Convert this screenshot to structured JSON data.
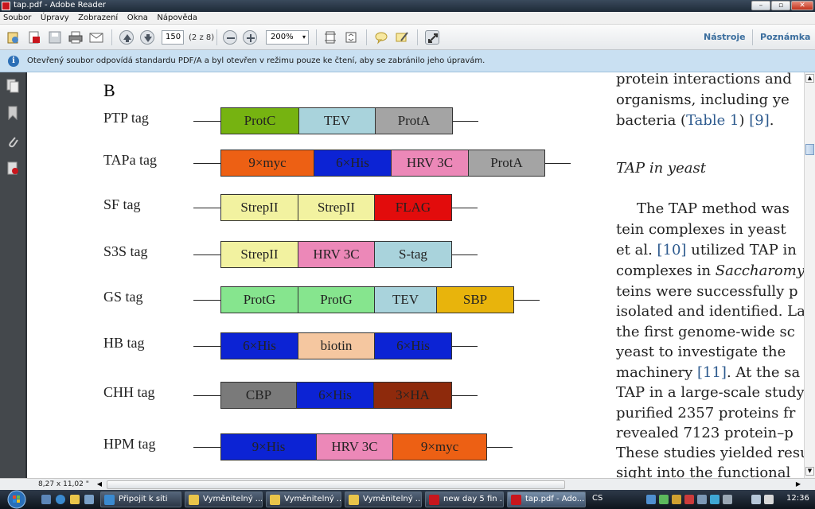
{
  "window": {
    "title": "tap.pdf - Adobe Reader",
    "controls": {
      "minimize": "–",
      "maximize": "▫",
      "close": "✕"
    }
  },
  "menu": [
    "Soubor",
    "Úpravy",
    "Zobrazení",
    "Okna",
    "Nápověda"
  ],
  "toolbar": {
    "page_number": "150",
    "page_label": "(2 z 8)",
    "zoom": "200%",
    "tools_label": "Nástroje",
    "comment_label": "Poznámka"
  },
  "infobar": {
    "message": "Otevřený soubor odpovídá standardu PDF/A a byl otevřen v režimu pouze ke čtení, aby se zabránilo jeho úpravám."
  },
  "document": {
    "figure_label": "B",
    "tags": [
      {
        "name": "PTP tag",
        "segments": [
          {
            "label": "ProtC",
            "color": "#76b311",
            "w": 98
          },
          {
            "label": "TEV",
            "color": "#a9d3dc",
            "w": 96
          },
          {
            "label": "ProtA",
            "color": "#a4a4a4",
            "w": 96
          }
        ]
      },
      {
        "name": "TAPa tag",
        "segments": [
          {
            "label": "9×myc",
            "color": "#ed6014",
            "w": 117
          },
          {
            "label": "6×His",
            "color": "#0c23d4",
            "w": 97
          },
          {
            "label": "HRV 3C",
            "color": "#ec88b8",
            "w": 97
          },
          {
            "label": "ProtA",
            "color": "#a4a4a4",
            "w": 95
          }
        ]
      },
      {
        "name": "SF tag",
        "segments": [
          {
            "label": "StrepII",
            "color": "#f2f2a0",
            "w": 97
          },
          {
            "label": "StrepII",
            "color": "#f2f2a0",
            "w": 96
          },
          {
            "label": "FLAG",
            "color": "#e20c0c",
            "w": 96
          }
        ]
      },
      {
        "name": "S3S tag",
        "segments": [
          {
            "label": "StrepII",
            "color": "#f2f2a0",
            "w": 97
          },
          {
            "label": "HRV 3C",
            "color": "#ec88b8",
            "w": 96
          },
          {
            "label": "S-tag",
            "color": "#a9d3dc",
            "w": 96
          }
        ]
      },
      {
        "name": "GS tag",
        "segments": [
          {
            "label": "ProtG",
            "color": "#86e58e",
            "w": 97
          },
          {
            "label": "ProtG",
            "color": "#86e58e",
            "w": 96
          },
          {
            "label": "TEV",
            "color": "#a9d3dc",
            "w": 78
          },
          {
            "label": "SBP",
            "color": "#e8b40c",
            "w": 96
          }
        ]
      },
      {
        "name": "HB tag",
        "segments": [
          {
            "label": "6×His",
            "color": "#0c23d4",
            "w": 97
          },
          {
            "label": "biotin",
            "color": "#f5c7a0",
            "w": 96
          },
          {
            "label": "6×His",
            "color": "#0c23d4",
            "w": 96
          }
        ]
      },
      {
        "name": "CHH tag",
        "segments": [
          {
            "label": "CBP",
            "color": "#7a7a7a",
            "w": 95
          },
          {
            "label": "6×His",
            "color": "#0c23d4",
            "w": 97
          },
          {
            "label": "3×HA",
            "color": "#8e2a0c",
            "w": 97
          }
        ]
      },
      {
        "name": "HPM tag",
        "segments": [
          {
            "label": "9×His",
            "color": "#0c23d4",
            "w": 120
          },
          {
            "label": "HRV 3C",
            "color": "#ec88b8",
            "w": 96
          },
          {
            "label": "9×myc",
            "color": "#ed6014",
            "w": 117
          }
        ]
      }
    ],
    "text_lines": [
      "protein interactions and",
      "organisms, including ye",
      "bacteria (Table 1) [9].",
      "TAP in yeast",
      "The TAP method was",
      "tein complexes in yeast",
      "et al. [10] utilized TAP in",
      "complexes in Saccharomy",
      "teins were successfully p",
      "isolated and identified. La",
      "the first genome-wide sc",
      "yeast to investigate the",
      "machinery [11]. At the sa",
      "TAP in a large-scale study",
      "purified 2357 proteins fr",
      "revealed 7123 protein–p",
      "These studies yielded resu",
      "sight into the functional"
    ]
  },
  "status": {
    "page_size": "8,27 x 11,02 \""
  },
  "taskbar": {
    "items": [
      {
        "label": "Připojit k síti",
        "color": "#3a8ad0"
      },
      {
        "label": "Vyměnitelný ...",
        "color": "#e9c54a"
      },
      {
        "label": "Vyměnitelný ...",
        "color": "#e9c54a"
      },
      {
        "label": "Vyměnitelný ...",
        "color": "#e9c54a"
      },
      {
        "label": "new day 5 fin ...",
        "color": "#c8161d"
      },
      {
        "label": "tap.pdf - Ado...",
        "color": "#c8161d"
      }
    ],
    "language": "CS",
    "clock": "12:36"
  }
}
